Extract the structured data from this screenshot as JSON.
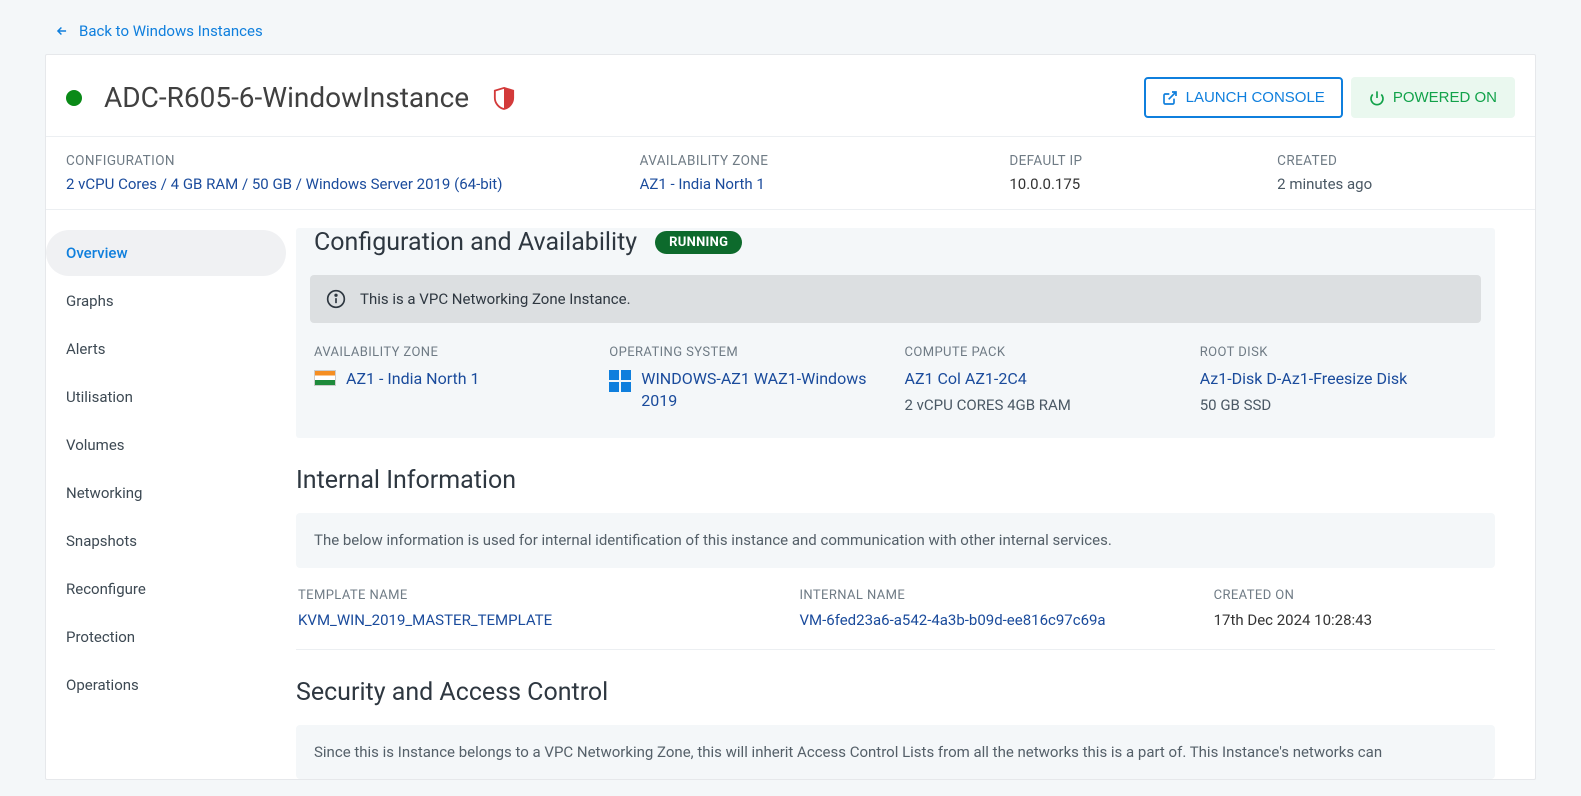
{
  "back": {
    "label": "Back to Windows Instances"
  },
  "header": {
    "title": "ADC-R605-6-WindowInstance",
    "launch": "LAUNCH CONSOLE",
    "power": "POWERED ON"
  },
  "summary": {
    "config_label": "CONFIGURATION",
    "config_value": "2 vCPU Cores / 4 GB RAM / 50 GB / Windows Server 2019 (64-bit)",
    "az_label": "AVAILABILITY ZONE",
    "az_value": "AZ1 - India North 1",
    "ip_label": "DEFAULT IP",
    "ip_value": "10.0.0.175",
    "created_label": "CREATED",
    "created_value": "2 minutes ago"
  },
  "sidebar": {
    "items": [
      "Overview",
      "Graphs",
      "Alerts",
      "Utilisation",
      "Volumes",
      "Networking",
      "Snapshots",
      "Reconfigure",
      "Protection",
      "Operations"
    ]
  },
  "config_panel": {
    "title": "Configuration and Availability",
    "badge": "RUNNING",
    "info": "This is a VPC Networking Zone Instance.",
    "az_label": "AVAILABILITY ZONE",
    "az_value": "AZ1 - India North 1",
    "os_label": "OPERATING SYSTEM",
    "os_value": "WINDOWS-AZ1 WAZ1-Windows 2019",
    "pack_label": "COMPUTE PACK",
    "pack_value": "AZ1 Col AZ1-2C4",
    "pack_sub": "2 vCPU CORES 4GB RAM",
    "disk_label": "ROOT DISK",
    "disk_value": "Az1-Disk D-Az1-Freesize Disk",
    "disk_sub": "50 GB SSD"
  },
  "internal": {
    "title": "Internal Information",
    "note": "The below information is used for internal identification of this instance and communication with other internal services.",
    "template_label": "TEMPLATE NAME",
    "template_value": "KVM_WIN_2019_MASTER_TEMPLATE",
    "internal_label": "INTERNAL NAME",
    "internal_value": "VM-6fed23a6-a542-4a3b-b09d-ee816c97c69a",
    "created_label": "CREATED ON",
    "created_value": "17th Dec 2024 10:28:43"
  },
  "security": {
    "title": "Security and Access Control",
    "note": "Since this is Instance belongs to a VPC Networking Zone, this will inherit Access Control Lists from all the networks this is a part of. This Instance's networks can"
  }
}
